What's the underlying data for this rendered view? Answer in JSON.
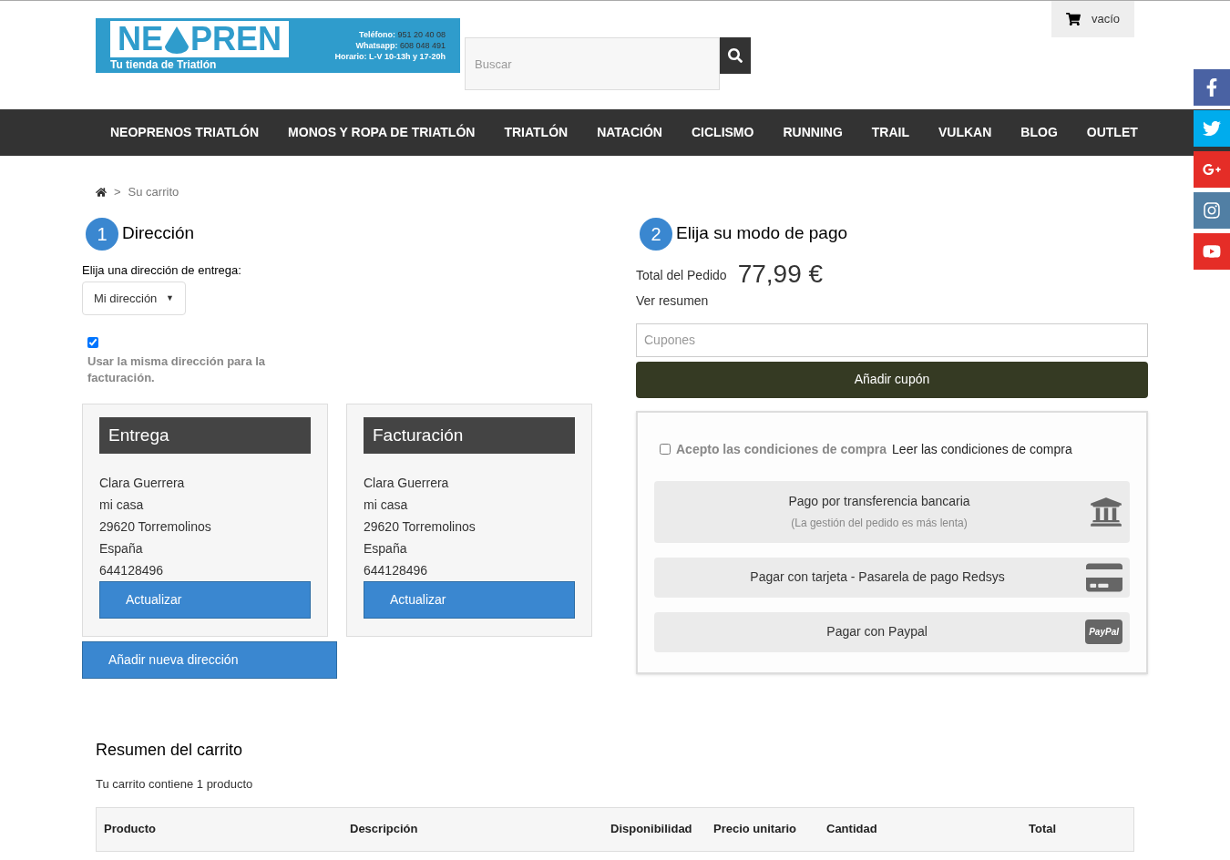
{
  "logo": {
    "left": "NE",
    "right": "PREN",
    "tagline": "Tu tienda de Triatlón",
    "contact": [
      {
        "label": "Teléfono:",
        "value": "951 20 40 08"
      },
      {
        "label": "Whatsapp:",
        "value": "608 048 491"
      },
      {
        "label": "Horario: L-V 10-13h y 17-20h"
      }
    ]
  },
  "search": {
    "placeholder": "Buscar"
  },
  "cart": {
    "label": "vacío"
  },
  "nav": [
    "NEOPRENOS TRIATLÓN",
    "MONOS Y ROPA DE TRIATLÓN",
    "TRIATLÓN",
    "NATACIÓN",
    "CICLISMO",
    "RUNNING",
    "TRAIL",
    "VULKAN",
    "BLOG",
    "OUTLET"
  ],
  "social": [
    {
      "kind": "facebook",
      "color": "#4a62a3"
    },
    {
      "kind": "twitter",
      "color": "#00aced"
    },
    {
      "kind": "googleplus",
      "color": "#e52d27"
    },
    {
      "kind": "instagram",
      "color": "#517fa4"
    },
    {
      "kind": "youtube",
      "color": "#e52d27"
    }
  ],
  "breadcrumb": {
    "separator": ">",
    "current": "Su carrito"
  },
  "address": {
    "step": "1",
    "title": "Dirección",
    "select_label": "Elija una dirección de entrega:",
    "select_value": "Mi dirección",
    "select_caret": "▼",
    "same_billing": {
      "checked": true,
      "label": "Usar la misma dirección para la facturación."
    },
    "cards": [
      {
        "title": "Entrega",
        "lines": [
          "Clara Guerrera",
          "mi casa",
          "29620 Torremolinos",
          "España",
          "644128496"
        ],
        "button": "Actualizar"
      },
      {
        "title": "Facturación",
        "lines": [
          "Clara Guerrera",
          "mi casa",
          "29620 Torremolinos",
          "España",
          "644128496"
        ],
        "button": "Actualizar"
      }
    ],
    "add_button": "Añadir nueva dirección"
  },
  "payment": {
    "step": "2",
    "title": "Elija su modo de pago",
    "total_label": "Total del Pedido",
    "total": "77,99 €",
    "summary_link": "Ver resumen",
    "coupon_placeholder": "Cupones",
    "coupon_button": "Añadir cupón",
    "terms": {
      "checked": false,
      "label": "Acepto las condiciones de compra",
      "link": "Leer las condiciones de compra"
    },
    "methods": [
      {
        "kind": "bank",
        "label": "Pago por transferencia bancaria",
        "note": "(La gestión del pedido es más lenta)"
      },
      {
        "kind": "card",
        "label": "Pagar con tarjeta - Pasarela de pago Redsys"
      },
      {
        "kind": "paypal",
        "label": "Pagar con Paypal",
        "badge": "PayPal"
      }
    ]
  },
  "summary": {
    "title": "Resumen del carrito",
    "count_text": "Tu carrito contiene 1 producto",
    "columns": [
      "Producto",
      "Descripción",
      "Disponibilidad",
      "Precio unitario",
      "Cantidad",
      "Total"
    ]
  }
}
